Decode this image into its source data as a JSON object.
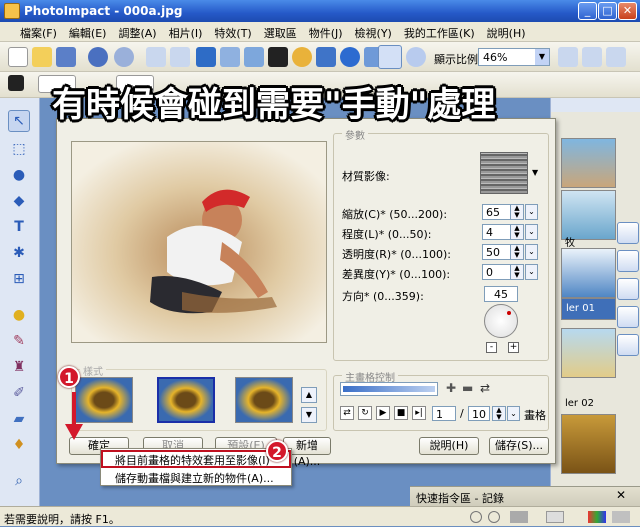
{
  "window": {
    "title": "PhotoImpact - 000a.jpg",
    "minimize": "_",
    "maximize": "□",
    "close": "✕"
  },
  "menubar": [
    "檔案(F)",
    "編輯(E)",
    "調整(A)",
    "相片(I)",
    "特效(T)",
    "選取區",
    "物件(J)",
    "檢視(Y)",
    "我的工作區(K)",
    "說明(H)"
  ],
  "toolbar": {
    "zoom_label": "顯示比例",
    "zoom_value": "46%"
  },
  "headline": "有時候會碰到需要\"手動\"處理",
  "dialog": {
    "params_legend": "參數",
    "texture_label": "材質影像:",
    "params": [
      {
        "label": "縮放(C)* (50...200):",
        "value": "65"
      },
      {
        "label": "程度(L)* (0...50):",
        "value": "4"
      },
      {
        "label": "透明度(R)* (0...100):",
        "value": "50"
      },
      {
        "label": "差異度(Y)* (0...100):",
        "value": "0"
      }
    ],
    "direction_label": "方向* (0...359):",
    "direction_value": "45",
    "dir_minus": "-",
    "dir_plus": "+",
    "presets_legend": "樣式",
    "keyframe_legend": "主畫格控制",
    "frame_current": "1",
    "frame_sep": "/",
    "frame_total": "10",
    "frame_unit": "畫格",
    "buttons": {
      "ok": "確定",
      "cancel": "取消",
      "reset": "預設(E)",
      "add": "新增(A)...",
      "help": "說明(H)",
      "save": "儲存(S)..."
    }
  },
  "context_menu": [
    "將目前畫格的特效套用至影像(I)",
    "儲存動畫檔與建立新的物件(A)..."
  ],
  "callouts": [
    "1",
    "2"
  ],
  "right_panel": {
    "tab1": "牧",
    "tab2": "ler 01",
    "tab3": "ler 02"
  },
  "quick_panel": "快速指令區 - 記錄",
  "status": "若需要說明，請按 F1。",
  "colors": {
    "titlebar": "#2559c8",
    "callout": "#d3182b",
    "highlight_box": "#c01020",
    "workspace": "#6a8fc2"
  }
}
